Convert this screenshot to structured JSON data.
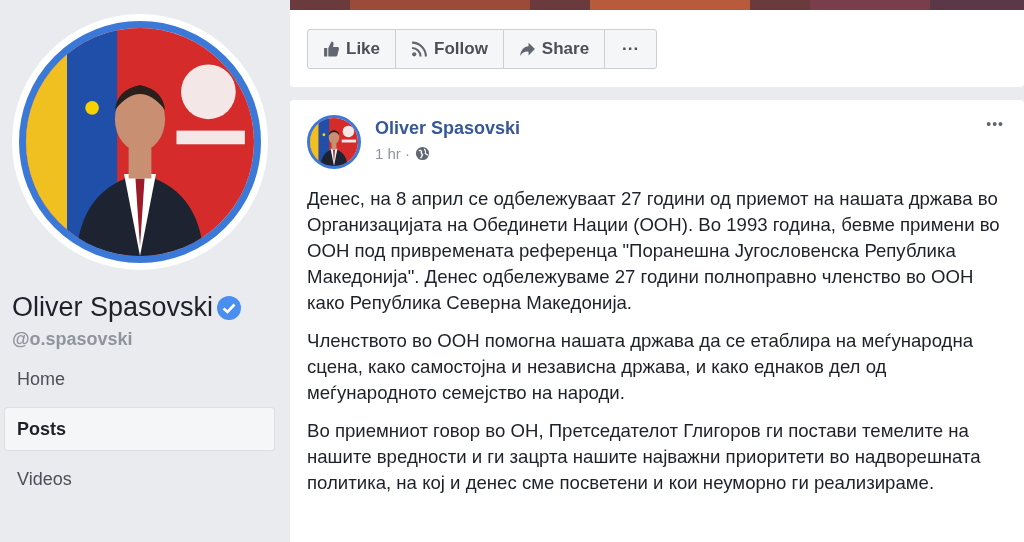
{
  "profile": {
    "name": "Oliver Spasovski",
    "verified": true,
    "handle": "@o.spasovski",
    "photo": {
      "kind": "picture"
    }
  },
  "nav": [
    {
      "label": "Home",
      "selected": false
    },
    {
      "label": "Posts",
      "selected": true
    },
    {
      "label": "Videos",
      "selected": false
    }
  ],
  "cover": {
    "kind": "picture"
  },
  "actions": [
    {
      "kind": "like",
      "label": "Like"
    },
    {
      "kind": "follow",
      "label": "Follow"
    },
    {
      "kind": "share",
      "label": "Share"
    },
    {
      "kind": "more",
      "label": "···"
    }
  ],
  "post": {
    "author": "Oliver Spasovski",
    "time": "1 hr ·",
    "menu": "•••",
    "avatar": {
      "kind": "picture"
    },
    "paragraphs": [
      "Денес, на 8 април се одбележуваат 27 години од приемот на нашата држава во Организацијата на Обединети Нации (ООН). Во 1993 година, бевме примени во ООН под привремената референца \"Поранешна Југословенска Република Македонија\". Денес одбележуваме 27 години полноправно членство во ООН како Република Северна Македонија.",
      "Членството во ООН помогна нашата држава да се етаблира на меѓународна сцена, како самостојна и независна држава, и како еднаков дел од меѓународното семејство на народи.",
      "Во приемниот говор во ОН, Претседателот Глигоров ги постави темелите на нашите вредности и ги зацрта нашите најважни приоритети во надворешната политика, на кој и денес сме посветени и кои неуморно ги реализираме."
    ]
  }
}
